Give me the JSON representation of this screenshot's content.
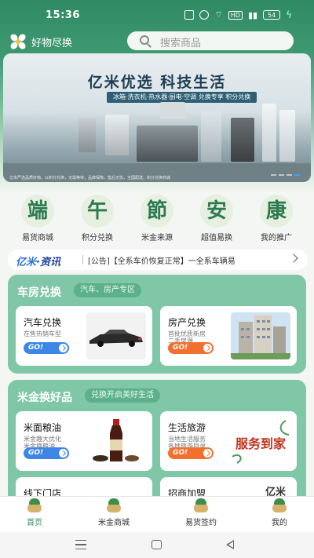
{
  "status": {
    "time": "15:36",
    "battery": "54",
    "network": "HD"
  },
  "header": {
    "app_title": "好物尽换",
    "search_placeholder": "搜索商品"
  },
  "banner": {
    "headline": "亿米优选  科技生活",
    "subline": "冰箱·洗衣机·热水器·厨电·空调 兑换专享 积分兑换",
    "fine_print": "亿米严选品质好物，以积分兑换，无需等待，品牌保障，售后无忧，全国配送，积分兑换商城"
  },
  "categories": [
    {
      "glyph": "端",
      "label": "易货商城"
    },
    {
      "glyph": "午",
      "label": "积分兑换"
    },
    {
      "glyph": "節",
      "label": "米金来源"
    },
    {
      "glyph": "安",
      "label": "超值易换"
    },
    {
      "glyph": "康",
      "label": "我的推广"
    }
  ],
  "news": {
    "brand": "亿米",
    "brand_suffix": "·资讯",
    "text": "[公告]【全系车价恢复正常】一全系车辆易"
  },
  "section1": {
    "title": "车房兑换",
    "subtitle": "汽车、房产专区",
    "cards": [
      {
        "title": "汽车兑换",
        "desc1": "在售热销车型",
        "desc2": "",
        "go": "GO!"
      },
      {
        "title": "房产兑换",
        "desc1": "首批优质新房",
        "desc2": "二手房源",
        "go": "GO!"
      }
    ]
  },
  "section2": {
    "title": "米金换好品",
    "subtitle": "兑换开启美好生活",
    "cards": [
      {
        "title": "米面粮油",
        "desc1": "米金趣大优化",
        "desc2": "米金换粮油",
        "go": "GO!"
      },
      {
        "title": "生活旅游",
        "desc1": "当地生活服务",
        "desc2": "各地旅游目录",
        "go": "GO!"
      }
    ],
    "partial_cards": [
      {
        "title": "线下门店"
      },
      {
        "title": "招商加盟",
        "badge": "亿米"
      }
    ],
    "stamp_text": "服务到家"
  },
  "tabs": [
    {
      "label": "首页",
      "icon": "zongzi-icon"
    },
    {
      "label": "米金商城",
      "icon": "zongzi-icon"
    },
    {
      "label": "易货签约",
      "icon": "zongzi-icon"
    },
    {
      "label": "我的",
      "icon": "zongzi-icon"
    }
  ],
  "colors": {
    "brand_green": "#2f8a63",
    "section_green": "#7fc7a6",
    "go_blue": "#3d86e6",
    "go_orange": "#f26f2e"
  }
}
